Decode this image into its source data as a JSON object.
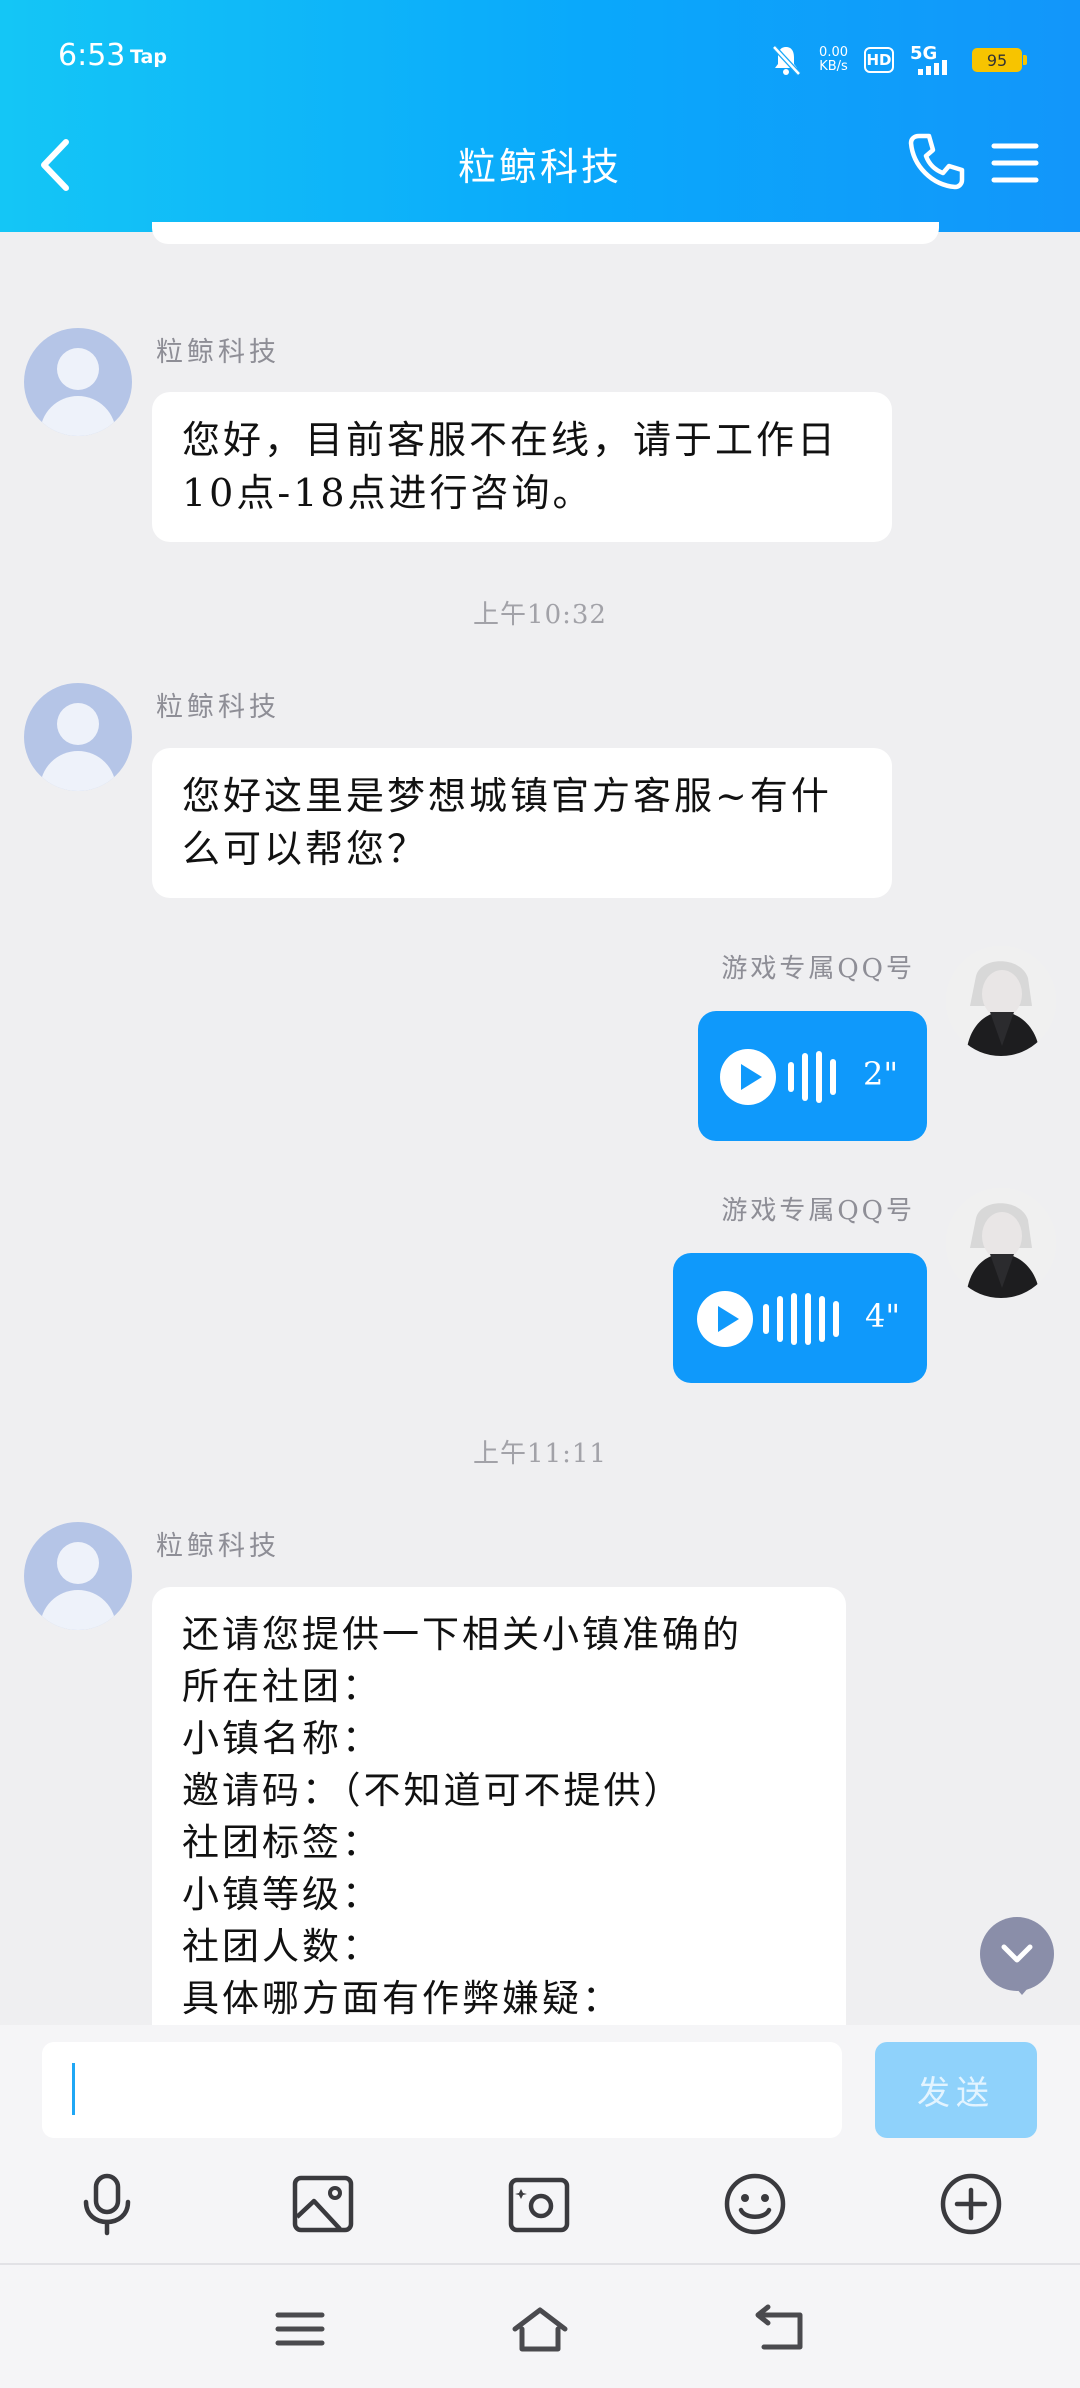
{
  "status_bar": {
    "time": "6:53",
    "app_label": "Tap",
    "net_speed_value": "0.00",
    "net_speed_unit": "KB/s",
    "hd_label": "HD",
    "network_label": "5G",
    "battery": "95"
  },
  "header": {
    "title": "粒鲸科技"
  },
  "messages": [
    {
      "sender": "粒鲸科技",
      "text": "您好，目前客服不在线，请于工作日10点-18点进行咨询。"
    },
    {
      "time": "上午10:32"
    },
    {
      "sender": "粒鲸科技",
      "text": "您好这里是梦想城镇官方客服~有什么可以帮您？"
    },
    {
      "sender": "游戏专属QQ号",
      "voice_duration": "2\""
    },
    {
      "sender": "游戏专属QQ号",
      "voice_duration": "4\""
    },
    {
      "time": "上午11:11"
    },
    {
      "sender": "粒鲸科技",
      "text": "还请您提供一下相关小镇准确的\n所在社团：\n小镇名称：\n邀请码：（不知道可不提供）\n社团标签：\n小镇等级：\n社团人数：\n具体哪方面有作弊嫌疑："
    }
  ],
  "input": {
    "value": "",
    "send_label": "发送"
  },
  "toolbar": {
    "icons": [
      "microphone-icon",
      "image-icon",
      "camera-icon",
      "emoji-icon",
      "plus-icon"
    ]
  },
  "nav_bar": {
    "icons": [
      "menu-icon",
      "home-icon",
      "back-icon"
    ]
  },
  "colors": {
    "header_start": "#14c6f6",
    "header_end": "#1296fa",
    "voice_bubble": "#0f99fb",
    "send_disabled": "#8fd2fb",
    "background": "#efeff1"
  }
}
